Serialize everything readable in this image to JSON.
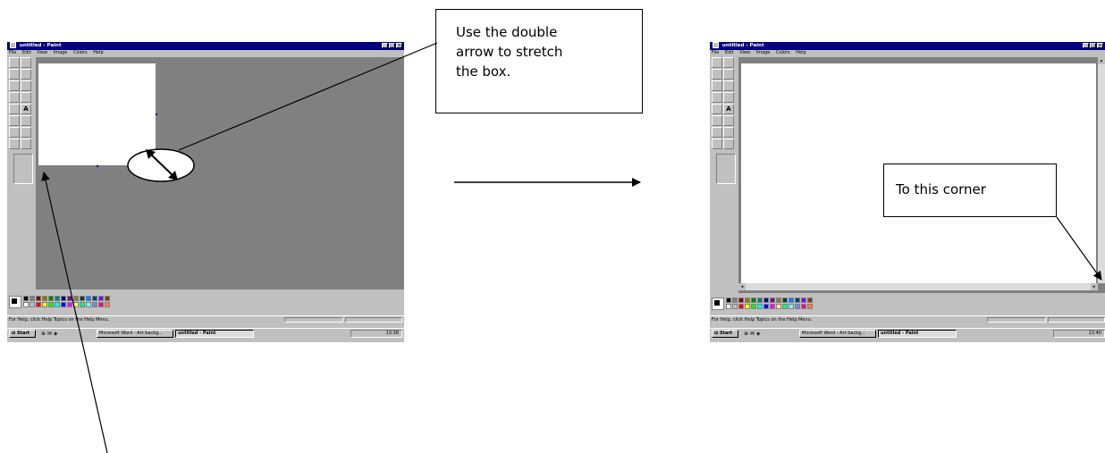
{
  "callouts": {
    "stretch_line1": "Use the double",
    "stretch_line2": "arrow to stretch",
    "stretch_line3": "the box.",
    "corner": "To this corner"
  },
  "left_window": {
    "title": "untitled - Paint",
    "menu": [
      "File",
      "Edit",
      "View",
      "Image",
      "Colors",
      "Help"
    ],
    "status": "For Help, click Help Topics on the Help Menu.",
    "taskbar": {
      "start": "Start",
      "word_task": "Microsoft Word - Art backg...",
      "paint_task": "untitled - Paint",
      "clock": "13:38"
    }
  },
  "right_window": {
    "title": "untitled - Paint",
    "menu": [
      "File",
      "Edit",
      "View",
      "Image",
      "Colors",
      "Help"
    ],
    "status": "For Help, click Help Topics on the Help Menu.",
    "taskbar": {
      "start": "Start",
      "word_task": "Microsoft Word - Art backg...",
      "paint_task": "untitled - Paint",
      "clock": "13:40"
    }
  },
  "tools": [
    "free-select",
    "rect-select",
    "eraser",
    "fill",
    "picker",
    "magnifier",
    "pencil",
    "brush",
    "airbrush",
    "text",
    "line",
    "curve",
    "rectangle",
    "polygon",
    "ellipse",
    "rounded-rect"
  ],
  "tool_glyphs": {
    "text": "A"
  },
  "palette_colors": [
    "#000000",
    "#808080",
    "#800000",
    "#808000",
    "#008000",
    "#008080",
    "#000080",
    "#800080",
    "#808040",
    "#004040",
    "#0080ff",
    "#004080",
    "#8000ff",
    "#804000",
    "#ffffff",
    "#c0c0c0",
    "#ff0000",
    "#ffff00",
    "#00ff00",
    "#00ffff",
    "#0000ff",
    "#ff00ff",
    "#ffff80",
    "#00ff80",
    "#80ffff",
    "#8080ff",
    "#ff0080",
    "#ff8040"
  ],
  "accent_colors": {
    "titlebar": "#000080",
    "workspace": "#808080",
    "canvas": "#ffffff"
  }
}
